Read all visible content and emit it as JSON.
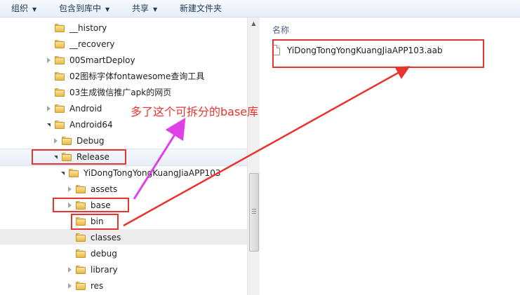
{
  "toolbar": {
    "organize": "组织",
    "include_in_library": "包含到库中",
    "share": "共享",
    "new_folder": "新建文件夹"
  },
  "tree": {
    "items": [
      {
        "label": "__history",
        "depth": 0,
        "expander": "none"
      },
      {
        "label": "__recovery",
        "depth": 0,
        "expander": "none"
      },
      {
        "label": "00SmartDeploy",
        "depth": 0,
        "expander": "closed"
      },
      {
        "label": "02图标字体fontawesome查询工具",
        "depth": 0,
        "expander": "none"
      },
      {
        "label": "03生成微信推广apk的网页",
        "depth": 0,
        "expander": "none"
      },
      {
        "label": "Android",
        "depth": 0,
        "expander": "closed"
      },
      {
        "label": "Android64",
        "depth": 0,
        "expander": "open"
      },
      {
        "label": "Debug",
        "depth": 1,
        "expander": "closed"
      },
      {
        "label": "Release",
        "depth": 1,
        "expander": "open"
      },
      {
        "label": "YiDongTongYongKuangJiaAPP103",
        "depth": 2,
        "expander": "open"
      },
      {
        "label": "assets",
        "depth": 3,
        "expander": "closed"
      },
      {
        "label": "base",
        "depth": 3,
        "expander": "closed"
      },
      {
        "label": "bin",
        "depth": 3,
        "expander": "none"
      },
      {
        "label": "classes",
        "depth": 3,
        "expander": "none"
      },
      {
        "label": "debug",
        "depth": 3,
        "expander": "none"
      },
      {
        "label": "library",
        "depth": 3,
        "expander": "closed"
      },
      {
        "label": "res",
        "depth": 3,
        "expander": "closed"
      }
    ]
  },
  "content": {
    "column_name": "名称",
    "files": [
      {
        "name": "YiDongTongYongKuangJiaAPP103.aab",
        "icon": "file-icon"
      }
    ]
  },
  "annotation": {
    "text": "多了这个可拆分的base库",
    "color": "#e8332f",
    "arrow_color_magenta": "#e040e8",
    "arrow_color_red": "#e8332f"
  }
}
